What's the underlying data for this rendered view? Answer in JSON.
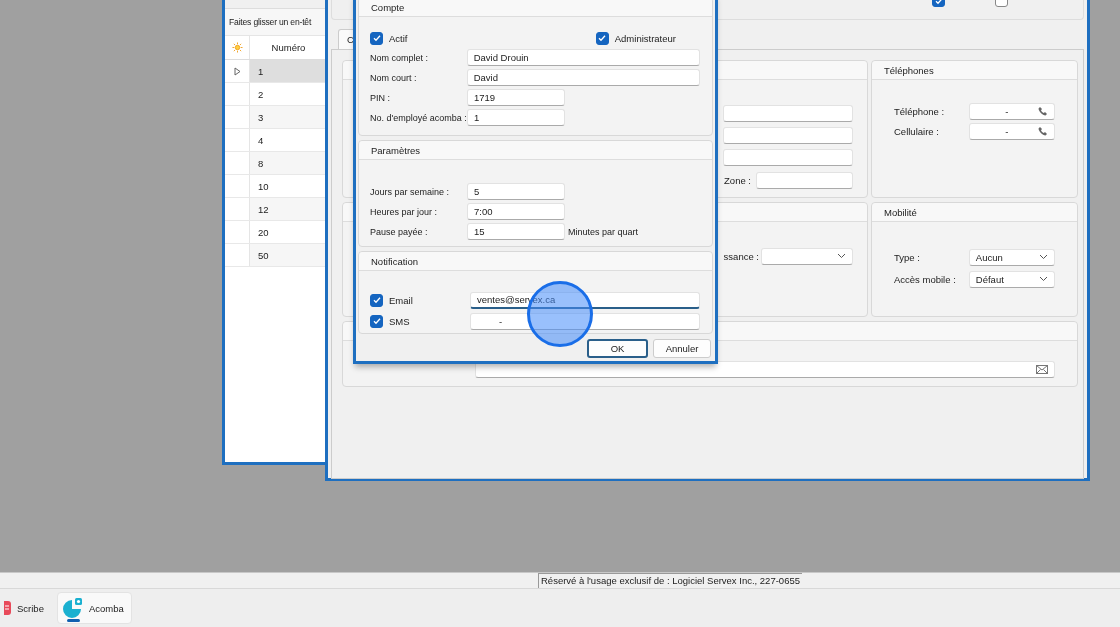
{
  "list_window": {
    "group_hint": "Faites glisser un en-têt",
    "column_header": "Numéro",
    "rows": [
      {
        "number": "1",
        "selected": true
      },
      {
        "number": "2",
        "selected": false
      },
      {
        "number": "3",
        "selected": false
      },
      {
        "number": "4",
        "selected": false
      },
      {
        "number": "8",
        "selected": false
      },
      {
        "number": "10",
        "selected": false
      },
      {
        "number": "12",
        "selected": false
      },
      {
        "number": "20",
        "selected": false
      },
      {
        "number": "50",
        "selected": false
      }
    ]
  },
  "employee_window": {
    "header_checkboxes": [
      {
        "checked": true
      },
      {
        "checked": false
      }
    ],
    "tabs": [
      {
        "label": "C",
        "selected": true
      }
    ],
    "zone_label": "Zone :",
    "dropdown_label": "ssance :",
    "phones": {
      "title": "Téléphones",
      "fields": [
        {
          "label": "Téléphone :",
          "value": "-"
        },
        {
          "label": "Cellulaire :",
          "value": "-"
        }
      ]
    },
    "mobility": {
      "title": "Mobilité",
      "fields": [
        {
          "label": "Type :",
          "value": "Aucun"
        },
        {
          "label": "Accès mobile :",
          "value": "Défaut"
        }
      ]
    }
  },
  "dialog": {
    "account": {
      "title": "Compte",
      "checkboxes": [
        {
          "label": "Actif",
          "checked": true
        },
        {
          "label": "Administrateur",
          "checked": true
        }
      ],
      "fields": [
        {
          "label": "Nom complet :",
          "value": "David Drouin"
        },
        {
          "label": "Nom court :",
          "value": "David"
        },
        {
          "label": "PIN :",
          "value": "1719"
        },
        {
          "label": "No. d'employé acomba :",
          "value": "1"
        }
      ]
    },
    "settings": {
      "title": "Paramètres",
      "fields": [
        {
          "label": "Jours par semaine :",
          "value": "5"
        },
        {
          "label": "Heures par jour :",
          "value": "7:00"
        },
        {
          "label": "Pause payée :",
          "value": "15",
          "unit": "Minutes par quart"
        }
      ]
    },
    "notification": {
      "title": "Notification",
      "channels": [
        {
          "label": "Email",
          "checked": true,
          "value": "ventes@servex.ca",
          "focused": true
        },
        {
          "label": "SMS",
          "checked": true,
          "value": "-",
          "focused": false
        }
      ]
    },
    "buttons": [
      {
        "label": "OK",
        "default": true
      },
      {
        "label": "Annuler",
        "default": false
      }
    ]
  },
  "status_bar": {
    "text": "Réservé à l'usage exclusif de : Logiciel Servex Inc., 227-0655"
  },
  "taskbar": [
    {
      "label": "Scribe",
      "selected": false
    },
    {
      "label": "Acomba",
      "selected": true
    }
  ]
}
